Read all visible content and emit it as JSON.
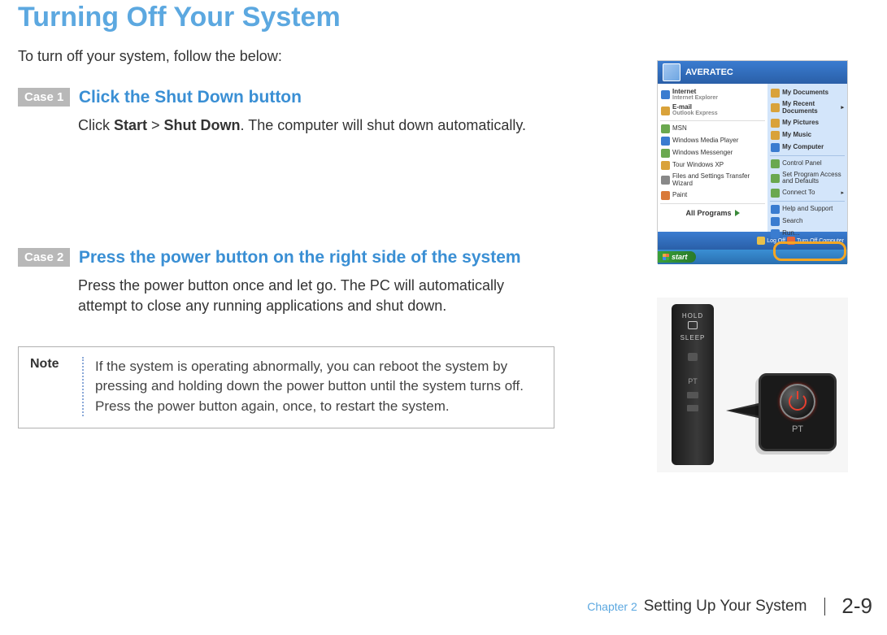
{
  "title": "Turning Off Your System",
  "intro": "To turn off your system, follow the below:",
  "case1": {
    "label": "Case 1",
    "heading": "Click the Shut Down button",
    "body_prefix": "Click ",
    "bold1": "Start",
    "sep": " > ",
    "bold2": "Shut Down",
    "body_suffix": ". The computer will shut down automatically."
  },
  "case2": {
    "label": "Case 2",
    "heading": "Press the power button on the right side of the system",
    "body": "Press the power button once and let go. The PC will automatically attempt to close any running applications and shut down."
  },
  "note": {
    "label": "Note",
    "body": "If the system is operating abnormally, you can reboot the system by pressing and holding down the power button until the system turns off. Press the power button again, once, to restart the system."
  },
  "start_menu": {
    "user": "AVERATEC",
    "left": [
      {
        "t": "Internet",
        "s": "Internet Explorer",
        "c": "#3a7cd0"
      },
      {
        "t": "E-mail",
        "s": "Outlook Express",
        "c": "#d9a23a"
      },
      {
        "t": "MSN",
        "c": "#6aa84f"
      },
      {
        "t": "Windows Media Player",
        "c": "#3a7cd0"
      },
      {
        "t": "Windows Messenger",
        "c": "#6aa84f"
      },
      {
        "t": "Tour Windows XP",
        "c": "#d9a23a"
      },
      {
        "t": "Files and Settings Transfer Wizard",
        "c": "#888"
      },
      {
        "t": "Paint",
        "c": "#d97a3a"
      }
    ],
    "all_programs": "All Programs",
    "right": [
      {
        "t": "My Documents",
        "b": true,
        "c": "#d9a23a"
      },
      {
        "t": "My Recent Documents",
        "b": true,
        "c": "#d9a23a",
        "arr": true
      },
      {
        "t": "My Pictures",
        "b": true,
        "c": "#d9a23a"
      },
      {
        "t": "My Music",
        "b": true,
        "c": "#d9a23a"
      },
      {
        "t": "My Computer",
        "b": true,
        "c": "#3a7cd0"
      },
      {
        "t": "Control Panel",
        "c": "#6aa84f"
      },
      {
        "t": "Set Program Access and Defaults",
        "c": "#6aa84f"
      },
      {
        "t": "Connect To",
        "c": "#6aa84f",
        "arr": true
      },
      {
        "t": "Help and Support",
        "c": "#3a7cd0"
      },
      {
        "t": "Search",
        "c": "#3a7cd0"
      },
      {
        "t": "Run...",
        "c": "#3a7cd0"
      }
    ],
    "logoff": "Log Off",
    "turnoff": "Turn Off Computer",
    "start": "start"
  },
  "power": {
    "hold": "HOLD",
    "sleep": "SLEEP",
    "pt": "PT"
  },
  "footer": {
    "chapter_label": "Chapter 2",
    "chapter_title": "Setting Up Your System",
    "page": "2-9"
  }
}
